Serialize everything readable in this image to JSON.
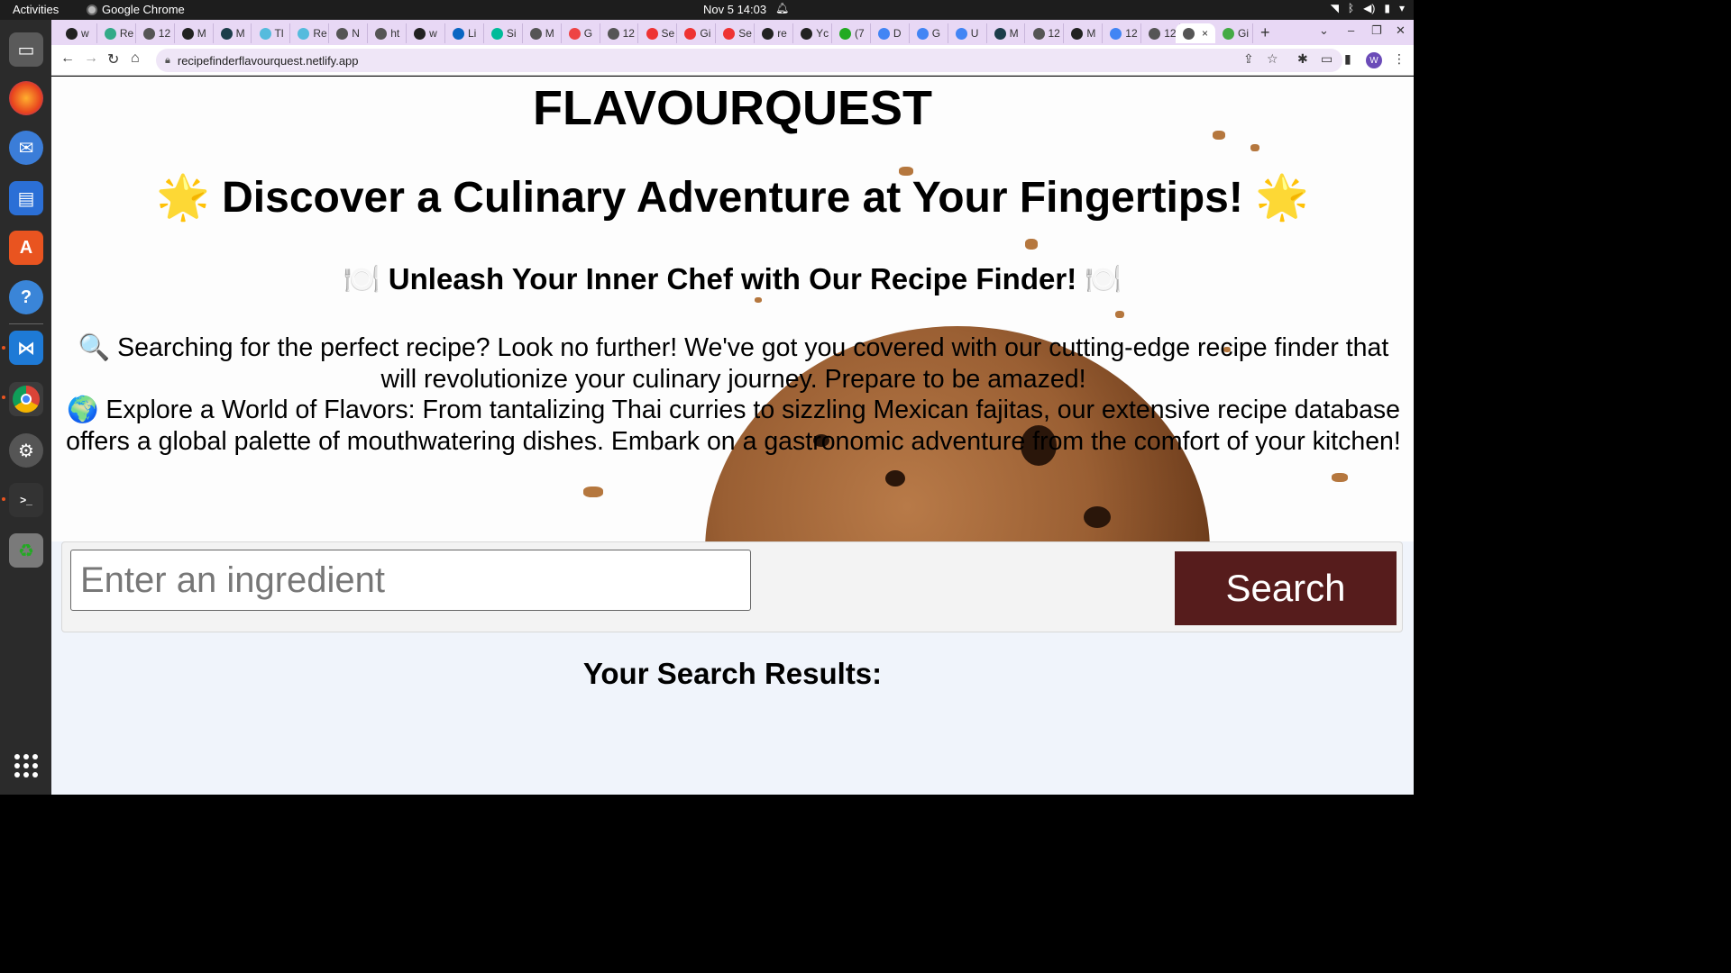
{
  "system": {
    "activities": "Activities",
    "app_name": "Google Chrome",
    "clock": "Nov 5  14:03"
  },
  "browser": {
    "tabs": [
      {
        "label": "w",
        "color": "#222"
      },
      {
        "label": "Re",
        "color": "#3a8"
      },
      {
        "label": "12",
        "color": "#555"
      },
      {
        "label": "M",
        "color": "#222"
      },
      {
        "label": "M",
        "color": "#1c3d4a"
      },
      {
        "label": "Tl",
        "color": "#5bd"
      },
      {
        "label": "Re",
        "color": "#5bd"
      },
      {
        "label": "N",
        "color": "#555"
      },
      {
        "label": "ht",
        "color": "#555"
      },
      {
        "label": "w",
        "color": "#222"
      },
      {
        "label": "Li",
        "color": "#0a66c2"
      },
      {
        "label": "Si",
        "color": "#0b9"
      },
      {
        "label": "M",
        "color": "#555"
      },
      {
        "label": "G",
        "color": "#e44"
      },
      {
        "label": "12",
        "color": "#555"
      },
      {
        "label": "Se",
        "color": "#e33"
      },
      {
        "label": "Gi",
        "color": "#e33"
      },
      {
        "label": "Se",
        "color": "#e33"
      },
      {
        "label": "re",
        "color": "#222"
      },
      {
        "label": "Yc",
        "color": "#222"
      },
      {
        "label": "(7",
        "color": "#2a2"
      },
      {
        "label": "D",
        "color": "#4285f4"
      },
      {
        "label": "G",
        "color": "#4285f4"
      },
      {
        "label": "U",
        "color": "#4285f4"
      },
      {
        "label": "M",
        "color": "#1c3d4a"
      },
      {
        "label": "12",
        "color": "#555"
      },
      {
        "label": "M",
        "color": "#222"
      },
      {
        "label": "12",
        "color": "#4285f4"
      },
      {
        "label": "12",
        "color": "#555"
      }
    ],
    "active_tab_close": "×",
    "last_tab": "Gi",
    "url": "recipefinderflavourquest.netlify.app"
  },
  "page": {
    "site_title": "FLAVOURQUEST",
    "tagline": "Discover a Culinary Adventure at Your Fingertips!",
    "tagline_emoji": "🌟",
    "subtagline": "Unleash Your Inner Chef with Our Recipe Finder!",
    "subtagline_emoji": "🍽️",
    "intro_line1_emoji": "🔍",
    "intro_line1": "Searching for the perfect recipe? Look no further! We've got you covered with our cutting-edge recipe finder that will revolutionize your culinary journey. Prepare to be amazed!",
    "intro_line2_emoji": "🌍",
    "intro_line2": "Explore a World of Flavors: From tantalizing Thai curries to sizzling Mexican fajitas, our extensive recipe database offers a global palette of mouthwatering dishes. Embark on a gastronomic adventure from the comfort of your kitchen!",
    "search": {
      "placeholder": "Enter an ingredient",
      "value": "",
      "button_label": "Search",
      "button_color": "#561c1c"
    },
    "results_heading": "Your Search Results:"
  }
}
